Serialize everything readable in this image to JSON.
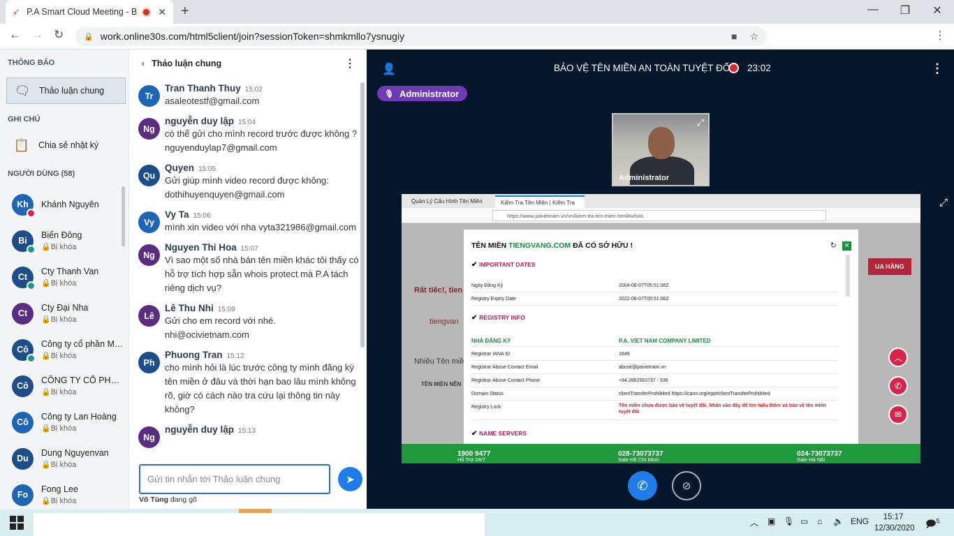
{
  "browser": {
    "tab_title": "P.A Smart Cloud Meeting - B",
    "url": "work.online30s.com/html5client/join?sessionToken=shmkmllo7ysnugiy"
  },
  "leftnav": {
    "notifications_title": "THÔNG BÁO",
    "public_chat": "Thảo luận chung",
    "notes_title": "GHI CHÚ",
    "shared_notes": "Chia sẻ nhật ký",
    "users_title": "NGƯỜI DÙNG (58)",
    "users": [
      {
        "initials": "Kh",
        "name": "Khánh Nguyên",
        "status": "",
        "color": "#1d66b4",
        "badge": "#d8234d"
      },
      {
        "initials": "Bi",
        "name": "Biển Đông",
        "status": "Bị khóa",
        "color": "#1d4e89",
        "badge": "#1a9a8a"
      },
      {
        "initials": "Ct",
        "name": "Cty Thanh Van",
        "status": "Bị khóa",
        "color": "#1d4e89",
        "badge": "#1a9a8a"
      },
      {
        "initials": "Ct",
        "name": "Cty Đại Nha",
        "status": "Bị khóa",
        "color": "#5a2d80",
        "badge": ""
      },
      {
        "initials": "Cô",
        "name": "Công ty cổ phần Mir…",
        "status": "Bị khóa",
        "color": "#1d4e89",
        "badge": "#1a9a8a"
      },
      {
        "initials": "Cô",
        "name": "CÔNG TY CỔ PHẦN …",
        "status": "Bị khóa",
        "color": "#1d4e89",
        "badge": ""
      },
      {
        "initials": "Cô",
        "name": "Công ty Lan Hoàng",
        "status": "Bị khóa",
        "color": "#1d66b4",
        "badge": ""
      },
      {
        "initials": "Du",
        "name": "Dung Nguyenvan",
        "status": "Bị khóa",
        "color": "#1d4e89",
        "badge": ""
      },
      {
        "initials": "Fo",
        "name": "Fong Lee",
        "status": "Bị khóa",
        "color": "#1d66b4",
        "badge": ""
      }
    ]
  },
  "chat": {
    "header": "Thảo luận chung",
    "messages": [
      {
        "initials": "Tr",
        "name": "Tran Thanh Thuy",
        "time": "15:02",
        "text": "asaleotestf@gmail.com",
        "color": "#1d66b4"
      },
      {
        "initials": "Ng",
        "name": "nguyễn duy lập",
        "time": "15:04",
        "text": "có thể gửi cho mình record trước được không ? nguyenduylap7@gmail.com",
        "color": "#5a2d80"
      },
      {
        "initials": "Qu",
        "name": "Quyen",
        "time": "15:05",
        "text": "Gửi giúp mình video record được không: dothihuyenquyen@gmail.com",
        "color": "#1d4e89"
      },
      {
        "initials": "Vy",
        "name": "Vy Ta",
        "time": "15:06",
        "text": "mình xin video với nha vyta321986@gmail.com",
        "color": "#1d66b4"
      },
      {
        "initials": "Ng",
        "name": "Nguyen Thi Hoa",
        "time": "15:07",
        "text": "Vì sao một số nhà bán tên miền khác tôi thấy có hỗ trợ tích hợp sẵn whois protect mà P.A tách riêng dịch vụ?",
        "color": "#5a2d80"
      },
      {
        "initials": "Lê",
        "name": "Lê Thu Nhi",
        "time": "15:09",
        "text": "Gửi cho em record với nhé. nhi@ocivietnam.com",
        "color": "#5a2d80"
      },
      {
        "initials": "Ph",
        "name": "Phuong Tran",
        "time": "15:12",
        "text": "cho mình hỏi là lúc trước công ty mình đăng ký tên miền ở đâu và thời hạn bao lâu mình không rõ, giờ có cách nào tra cứu lại thông tin này không?",
        "color": "#1d4e89"
      },
      {
        "initials": "Ng",
        "name": "nguyễn duy lập",
        "time": "15:13",
        "text": "",
        "color": "#5a2d80"
      }
    ],
    "input_placeholder": "Gửi tin nhắn tới Thảo luận chung",
    "typing_user": "Võ Tùng",
    "typing_suffix": " đang gõ"
  },
  "meeting": {
    "title": "BẢO VỆ TÊN MIỀN AN TOÀN TUYỆT ĐỐI",
    "timer": "23:02",
    "presenter": "Administrator",
    "webcam_label": "Administrator"
  },
  "shared_screen": {
    "tab1": "Quản Lý Cấu Hình Tên Miền",
    "tab2": "Kiểm Tra Tên Miền | Kiểm Tra",
    "url": "https://www.pavietnam.vn/vn/kiem-tra-ten-mien.html#whois",
    "bg_text_1": "Rất tiếc!, tien",
    "bg_text_2": "tiengvan",
    "bg_text_3": "Nhiều Tên miền",
    "bg_text_4": "TÊN MIỀN NÊN",
    "bg_text_5": "UA HÀNG",
    "modal_title_prefix": "TÊN MIỀN ",
    "modal_domain": "TIENGVANG.COM",
    "modal_title_suffix": " ĐÃ CÓ SỞ HỮU !",
    "important_dates": "IMPORTANT DATES",
    "reg_date_label": "Ngày Đăng Ký",
    "reg_date": "2004-08-07T05:51:06Z",
    "expiry_label": "Registry Expiry Date",
    "expiry": "2022-08-07T05:51:06Z",
    "registry_info": "REGISTRY INFO",
    "registrar_label": "NHÀ ĐĂNG KÝ",
    "registrar": "P.A. VIET NAM COMPANY LIMITED",
    "iana_label": "Registrar IANA ID",
    "iana": "1649",
    "abuse_email_label": "Registrar Abuse Contact Email",
    "abuse_email": "abuse@pavietnam.vn",
    "abuse_phone_label": "Registrar Abuse Contact Phone",
    "abuse_phone": "+84.2862563737 - 536",
    "status_label": "Domain Status",
    "status": "clientTransferProhibited https://icann.org/epp#clientTransferProhibited",
    "lock_label": "Registry Lock",
    "lock": "Tên miền chưa được bảo vệ tuyệt đối. Nhấn vào đây để tìm hiểu thêm và bảo vệ tên miền tuyệt đối",
    "name_servers": "NAME SERVERS",
    "footer_1_label": "Hỗ Trợ 24/7 ",
    "footer_1": "1900 9477",
    "footer_2_label": "Sale Hồ Chí Minh ",
    "footer_2": "028-73073737",
    "footer_3_label": "Sale Hà Nội ",
    "footer_3": "024-73073737"
  },
  "taskbar": {
    "lang": "ENG",
    "time": "15:17",
    "date": "12/30/2020",
    "notif_count": "5"
  },
  "icons": [
    "back-arrow-icon",
    "forward-arrow-icon",
    "reload-icon",
    "lock-icon",
    "camera-blocked-icon",
    "star-icon",
    "chat-bubble-icon",
    "notes-icon",
    "user-icon",
    "record-icon",
    "mic-icon",
    "expand-icon",
    "phone-icon",
    "video-off-icon",
    "send-icon",
    "windows-icon"
  ]
}
